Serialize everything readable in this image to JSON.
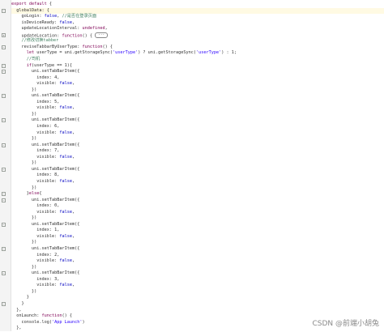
{
  "lines": [
    "export default {",
    "  globalData: {",
    "    goLogin: false, //是否在登录页面",
    "    isDeviceReady: false,",
    "    updateLocationInterval: undefined,",
    "    updateLocation: function() {",
    "    //修改切换tabber",
    "    reviseTabbarByUserType: function() {",
    "      let userType = uni.getStorageSync('userType') ? uni.getStorageSync('userType') : 1;",
    "      //司机",
    "      if(userType == 1){",
    "        uni.setTabBarItem({",
    "          index: 4,",
    "          visible: false,",
    "        })",
    "        uni.setTabBarItem({",
    "          index: 5,",
    "          visible: false,",
    "        })",
    "        uni.setTabBarItem({",
    "          index: 6,",
    "          visible: false,",
    "        })",
    "        uni.setTabBarItem({",
    "          index: 7,",
    "          visible: false,",
    "        })",
    "        uni.setTabBarItem({",
    "          index: 8,",
    "          visible: false,",
    "        })",
    "      }else{",
    "        uni.setTabBarItem({",
    "          index: 0,",
    "          visible: false,",
    "        })",
    "        uni.setTabBarItem({",
    "          index: 1,",
    "          visible: false,",
    "        })",
    "        uni.setTabBarItem({",
    "          index: 2,",
    "          visible: false,",
    "        })",
    "        uni.setTabBarItem({",
    "          index: 3,",
    "          visible: false,",
    "        })",
    "      }",
    "    }",
    "  },",
    "  onLaunch: function() {",
    "    console.log('App Launch')",
    "  },"
  ],
  "collapsed_label": "···",
  "watermark": "CSDN @前端小胡兔"
}
